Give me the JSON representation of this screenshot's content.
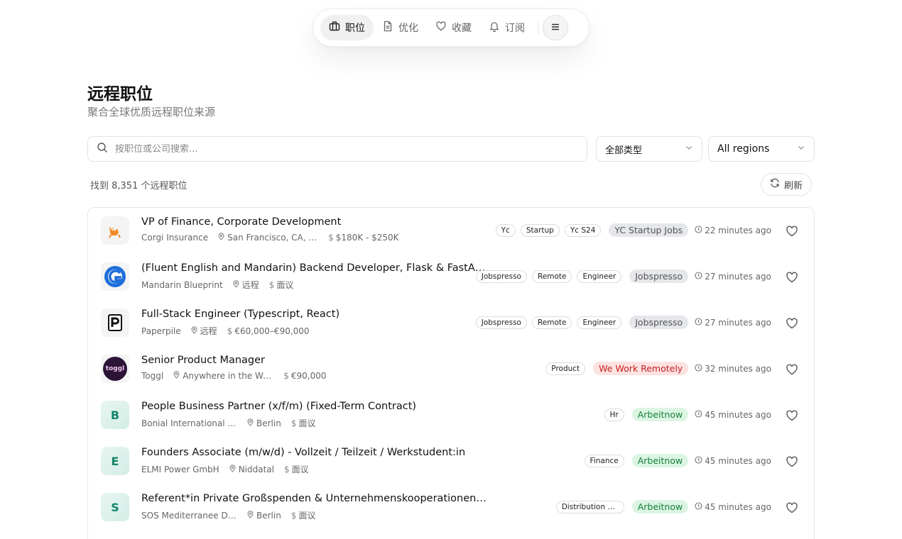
{
  "nav": {
    "items": [
      {
        "label": "职位",
        "icon": "briefcase-icon",
        "active": true
      },
      {
        "label": "优化",
        "icon": "document-icon",
        "active": false
      },
      {
        "label": "收藏",
        "icon": "heart-icon",
        "active": false
      },
      {
        "label": "订阅",
        "icon": "bell-icon",
        "active": false
      }
    ],
    "menu_icon": "menu-icon"
  },
  "header": {
    "title": "远程职位",
    "subtitle": "聚合全球优质远程职位来源"
  },
  "search": {
    "placeholder": "按职位或公司搜索..."
  },
  "filters": {
    "type": "全部类型",
    "region": "All regions"
  },
  "results": {
    "count_text": "找到 8,351 个远程职位",
    "refresh_label": "刷新"
  },
  "colors": {
    "source_gray_bg": "#e5e7eb",
    "source_gray_fg": "#555555",
    "source_red_bg": "#fde2e2",
    "source_red_fg": "#c81e1e",
    "source_green_bg": "#dcf5e3",
    "source_green_fg": "#15803d"
  },
  "jobs": [
    {
      "title": "VP of Finance, Corporate Development",
      "company": "Corgi Insurance",
      "location": "San Francisco, CA, U...",
      "salary": "$180K - $250K",
      "tags": [
        "Yc",
        "Startup",
        "Yc S24"
      ],
      "source": "YC Startup Jobs",
      "source_style": "gray",
      "time": "22 minutes ago",
      "logo": {
        "type": "image",
        "icon": "corgi-logo"
      }
    },
    {
      "title": "(Fluent English and Mandarin) Backend Developer, Flask & FastAPI Specialist",
      "company": "Mandarin Blueprint",
      "location": "远程",
      "salary": "面议",
      "tags": [
        "Jobspresso",
        "Remote",
        "Engineer"
      ],
      "source": "Jobspresso",
      "source_style": "gray",
      "time": "27 minutes ago",
      "logo": {
        "type": "image",
        "icon": "mandarin-blueprint-logo"
      }
    },
    {
      "title": "Full-Stack Engineer (Typescript, React)",
      "company": "Paperpile",
      "location": "远程",
      "salary": "€60,000–€90,000",
      "tags": [
        "Jobspresso",
        "Remote",
        "Engineer"
      ],
      "source": "Jobspresso",
      "source_style": "gray",
      "time": "27 minutes ago",
      "logo": {
        "type": "image",
        "icon": "paperpile-logo"
      }
    },
    {
      "title": "Senior Product Manager",
      "company": "Toggl",
      "location": "Anywhere in the Wo...",
      "salary": "€90,000",
      "tags": [
        "Product"
      ],
      "source": "We Work Remotely",
      "source_style": "red",
      "time": "32 minutes ago",
      "logo": {
        "type": "image",
        "icon": "toggl-logo",
        "text": "toggl"
      }
    },
    {
      "title": "People Business Partner (x/f/m) (Fixed-Term Contract)",
      "company": "Bonial International G...",
      "location": "Berlin",
      "salary": "面议",
      "tags": [
        "Hr"
      ],
      "source": "Arbeitnow",
      "source_style": "green",
      "time": "45 minutes ago",
      "logo": {
        "type": "letter",
        "text": "B"
      }
    },
    {
      "title": "Founders Associate (m/w/d) - Vollzeit / Teilzeit / Werkstudent:in",
      "company": "ELMI Power GmbH",
      "location": "Niddatal",
      "salary": "面议",
      "tags": [
        "Finance"
      ],
      "source": "Arbeitnow",
      "source_style": "green",
      "time": "45 minutes ago",
      "logo": {
        "type": "letter",
        "text": "E"
      }
    },
    {
      "title": "Referent*in Private Großspenden & Unternehmenskooperationen (m/w/d)",
      "company": "SOS Mediterranee Deu...",
      "location": "Berlin",
      "salary": "面议",
      "tags": [
        "Distribution Management"
      ],
      "source": "Arbeitnow",
      "source_style": "green",
      "time": "45 minutes ago",
      "logo": {
        "type": "letter",
        "text": "S"
      }
    }
  ]
}
